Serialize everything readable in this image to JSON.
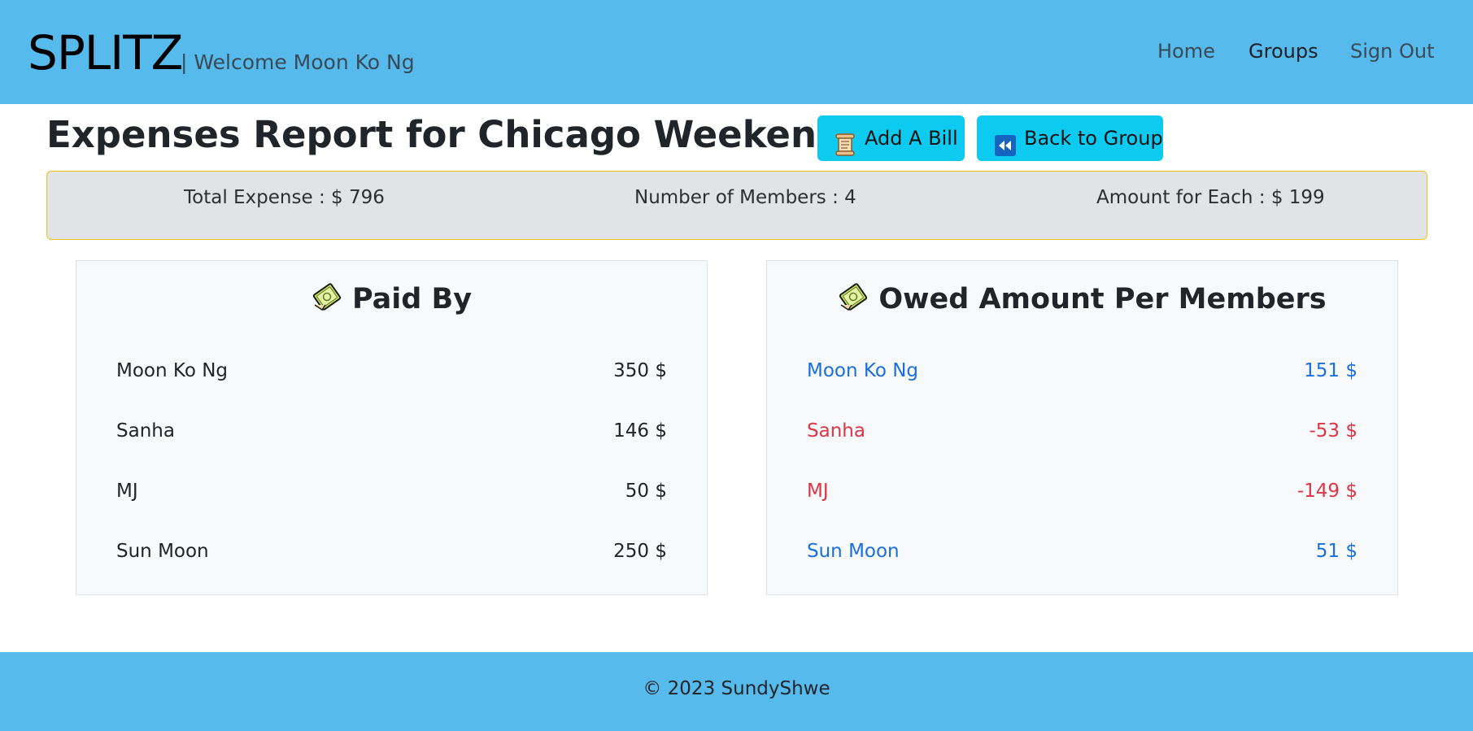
{
  "header": {
    "brand": "SPLITZ",
    "welcome": "| Welcome Moon Ko Ng",
    "nav": {
      "home": "Home",
      "groups": "Groups",
      "sign_out": "Sign Out"
    }
  },
  "page": {
    "title": "Expenses Report for Chicago Weekend Trip",
    "add_bill_label": "Add A Bill",
    "back_label": "Back to Group"
  },
  "summary": {
    "total": "Total Expense : $ 796",
    "members": "Number of Members : 4",
    "each": "Amount for Each : $ 199"
  },
  "paid_by": {
    "title": "Paid By",
    "rows": [
      {
        "name": "Moon Ko Ng",
        "amount": "350 $"
      },
      {
        "name": "Sanha",
        "amount": "146 $"
      },
      {
        "name": "MJ",
        "amount": "50 $"
      },
      {
        "name": "Sun Moon",
        "amount": "250 $"
      }
    ]
  },
  "owed": {
    "title": "Owed Amount Per Members",
    "rows": [
      {
        "name": "Moon Ko Ng",
        "amount": "151 $",
        "status": "positive"
      },
      {
        "name": "Sanha",
        "amount": "-53 $",
        "status": "negative"
      },
      {
        "name": "MJ",
        "amount": "-149 $",
        "status": "negative"
      },
      {
        "name": "Sun Moon",
        "amount": "51 $",
        "status": "positive"
      }
    ]
  },
  "footer": {
    "copyright": "© 2023 SundyShwe"
  },
  "colors": {
    "header_bg": "#56baed",
    "button_bg": "#0dcaf0",
    "positive": "#1a6fe0",
    "negative": "#dc3545",
    "summary_border": "#f0c419"
  },
  "icons": {
    "add_bill": "scroll-icon",
    "back": "rewind-icon",
    "card_title": "money-icon"
  }
}
